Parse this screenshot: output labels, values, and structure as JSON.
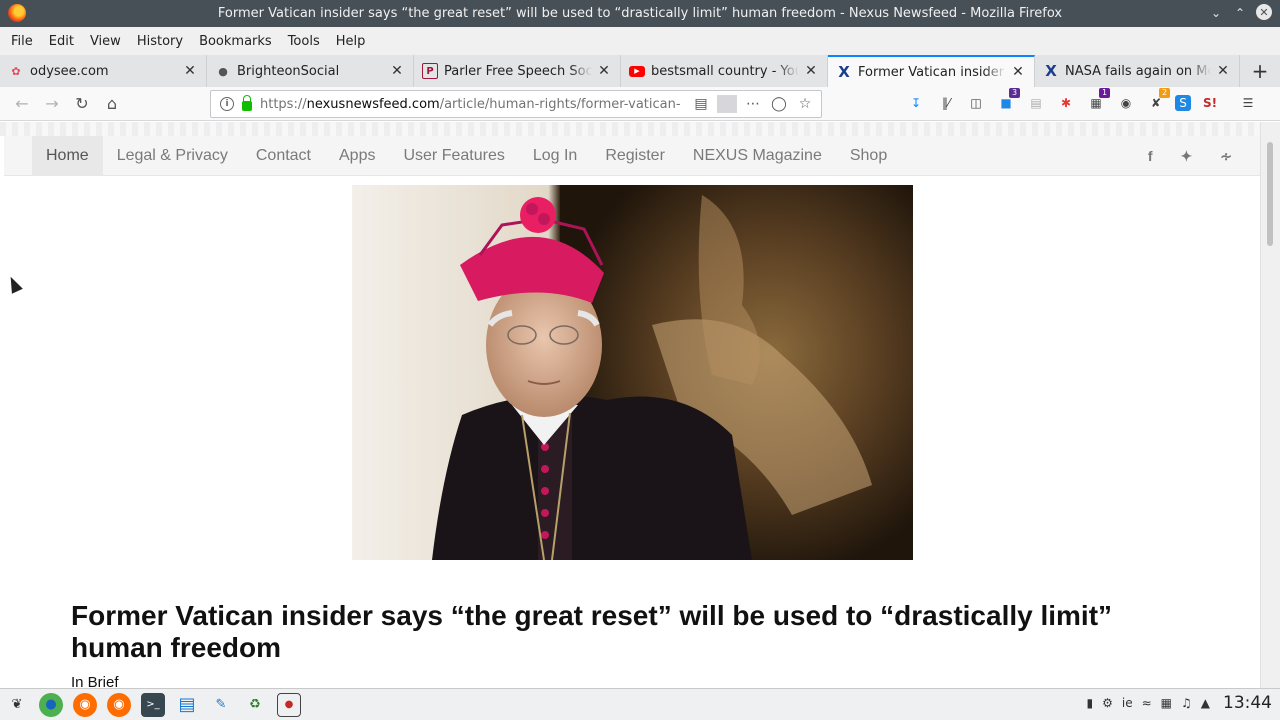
{
  "window": {
    "title": "Former Vatican insider says “the great reset” will be used to “drastically limit” human freedom - Nexus Newsfeed - Mozilla Firefox"
  },
  "menu": [
    "File",
    "Edit",
    "View",
    "History",
    "Bookmarks",
    "Tools",
    "Help"
  ],
  "tabs": [
    {
      "label": "odysee.com",
      "icon": "odysee-icon",
      "active": false
    },
    {
      "label": "BrighteonSocial",
      "icon": "brighteon-icon",
      "active": false
    },
    {
      "label": "Parler Free Speech Social",
      "icon": "parler-icon",
      "active": false
    },
    {
      "label": "bestsmall country - YouTube",
      "icon": "youtube-icon",
      "active": false
    },
    {
      "label": "Former Vatican insider says",
      "icon": "nexus-icon",
      "active": true
    },
    {
      "label": "NASA fails again on Moon",
      "icon": "nexus-icon",
      "active": false
    }
  ],
  "navbar": {
    "url_prefix": "https://",
    "url_host": "nexusnewsfeed.com",
    "url_path": "/article/human-rights/former-vatican-inside",
    "badges": {
      "ext1": "3",
      "ext2": "1",
      "ext3": "2"
    }
  },
  "site": {
    "nav": [
      "Home",
      "Legal & Privacy",
      "Contact",
      "Apps",
      "User Features",
      "Log In",
      "Register",
      "NEXUS Magazine",
      "Shop"
    ],
    "social": [
      "f",
      "t",
      "rss"
    ]
  },
  "article": {
    "title": "Former Vatican insider says “the great reset” will be used to “drastically limit” human freedom",
    "in_brief": "In Brief"
  },
  "taskbar": {
    "tray_lang": "ie",
    "clock": "13:44"
  }
}
